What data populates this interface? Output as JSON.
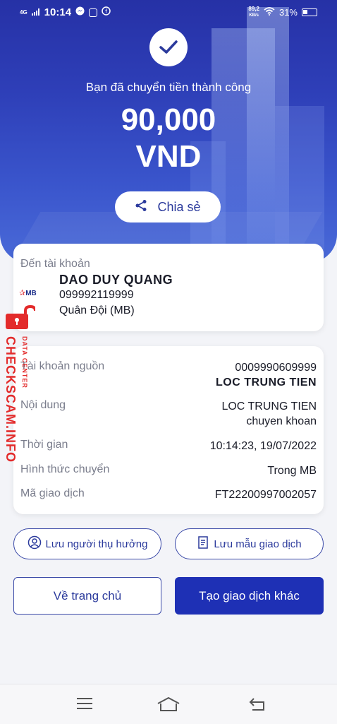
{
  "status_bar": {
    "network": "4G",
    "time": "10:14",
    "speed_value": "89,2",
    "speed_unit": "KB/s",
    "battery": "31%"
  },
  "hero": {
    "success_message": "Bạn đã chuyển tiền thành công",
    "amount": "90,000",
    "currency": "VND",
    "share_label": "Chia sẻ"
  },
  "recipient": {
    "label": "Đến tài khoản",
    "name": "DAO DUY QUANG",
    "account": "099992119999",
    "bank": "Quân Đội (MB)",
    "bank_logo_text": "MB"
  },
  "details": [
    {
      "key": "Tài khoản nguồn",
      "value": "0009990609999",
      "value2": "LOC TRUNG TIEN"
    },
    {
      "key": "Nội dung",
      "value": "LOC TRUNG TIEN",
      "value2": "chuyen khoan"
    },
    {
      "key": "Thời gian",
      "value": "10:14:23, 19/07/2022"
    },
    {
      "key": "Hình thức chuyển",
      "value": "Trong MB"
    },
    {
      "key": "Mã giao dịch",
      "value": "FT22200997002057"
    }
  ],
  "actions": {
    "save_beneficiary": "Lưu người thụ hưởng",
    "save_template": "Lưu mẫu giao dịch",
    "home": "Về trang chủ",
    "new_transaction": "Tạo giao dịch khác"
  },
  "watermark": {
    "site": "CHECKSCAM.INFO",
    "sub": "DATA CENTER"
  },
  "colors": {
    "primary": "#1e30b5",
    "hero": "#2e3fb8",
    "watermark": "#e32b2b"
  }
}
